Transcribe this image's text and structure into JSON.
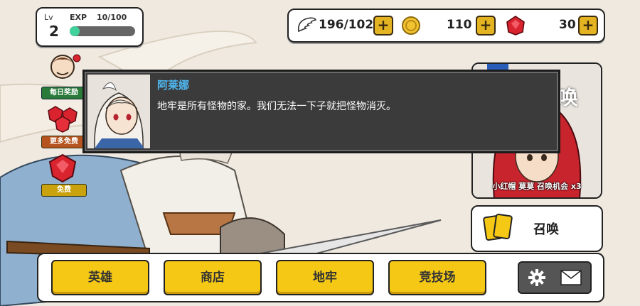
{
  "player": {
    "level_label": "Lv",
    "level": "2",
    "exp_label": "EXP",
    "exp_text": "10/100",
    "exp_fraction": 0.1
  },
  "resources": {
    "wings": "196/102",
    "gold": "110",
    "gems": "30"
  },
  "side": {
    "daily_reward": "每日奖励",
    "more_free": "更多免费",
    "free": "免费"
  },
  "dialog": {
    "speaker": "阿莱娜",
    "text": "地牢是所有怪物的家。我们无法一下子就把怪物消灭。"
  },
  "summon": {
    "banner_text": "唤",
    "caption": "小红帽 莫莫 召唤机会 x3",
    "button_label": "召唤"
  },
  "nav": {
    "heroes": "英雄",
    "shop": "商店",
    "dungeon": "地牢",
    "arena": "竞技场"
  },
  "colors": {
    "accent_yellow": "#f4c814",
    "exp_green": "#41d19a",
    "speaker_blue": "#4fb8f0",
    "dialog_bg": "#3b3b3b"
  }
}
